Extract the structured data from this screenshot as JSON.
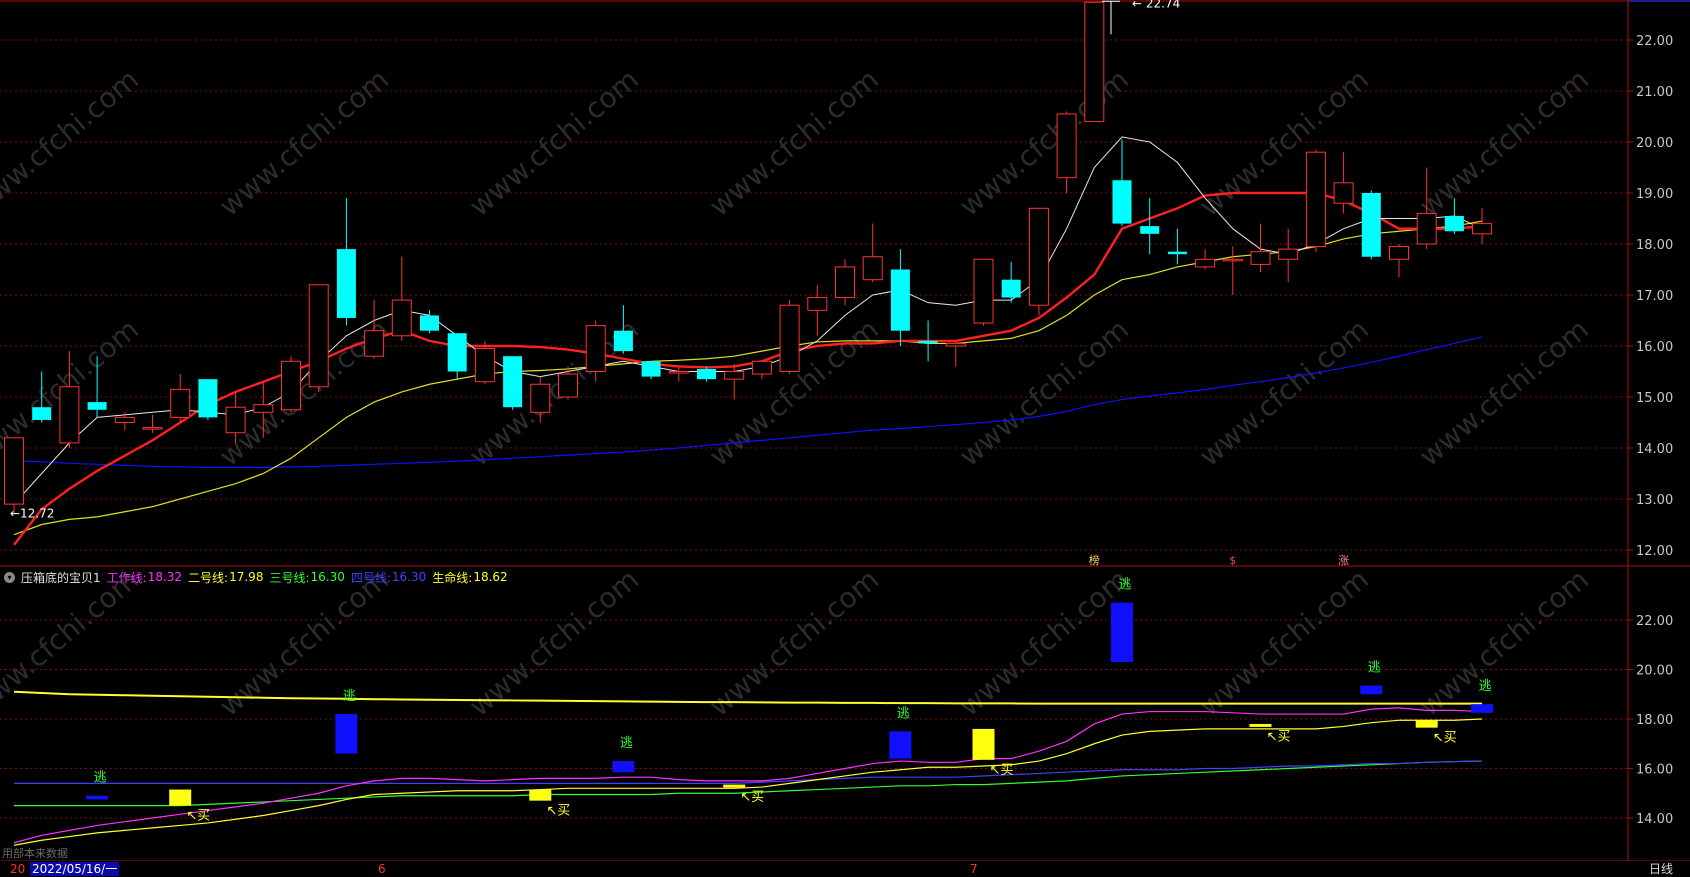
{
  "chart_data": [
    {
      "type": "candlestick",
      "ylim": [
        11.8,
        23.0
      ],
      "y_ticks": [
        "12.00",
        "13.00",
        "14.00",
        "15.00",
        "16.00",
        "17.00",
        "18.00",
        "19.00",
        "20.00",
        "21.00",
        "22.00"
      ],
      "top_tick_partial": "22.88",
      "grid": true,
      "annotations": [
        {
          "text": "22.74",
          "x": 40,
          "y": 22.74
        },
        {
          "text": "12.72",
          "x": 0,
          "y": 12.72
        }
      ],
      "event_marks": [
        {
          "text": "榜",
          "x": 39,
          "color": "#ffcc66"
        },
        {
          "text": "$",
          "x": 44,
          "color": "#ff4040"
        },
        {
          "text": "涨",
          "x": 48,
          "color": "#ff8080"
        }
      ],
      "candles": [
        {
          "o": 12.9,
          "h": 14.2,
          "l": 12.7,
          "c": 14.2
        },
        {
          "o": 14.8,
          "h": 15.5,
          "l": 14.5,
          "c": 14.55
        },
        {
          "o": 14.1,
          "h": 15.9,
          "l": 14.0,
          "c": 15.2
        },
        {
          "o": 14.9,
          "h": 15.8,
          "l": 14.6,
          "c": 14.75
        },
        {
          "o": 14.5,
          "h": 14.7,
          "l": 14.35,
          "c": 14.6
        },
        {
          "o": 14.4,
          "h": 14.65,
          "l": 14.3,
          "c": 14.4
        },
        {
          "o": 14.6,
          "h": 15.45,
          "l": 14.5,
          "c": 15.15
        },
        {
          "o": 15.35,
          "h": 15.35,
          "l": 14.55,
          "c": 14.6
        },
        {
          "o": 14.3,
          "h": 15.1,
          "l": 14.1,
          "c": 14.8
        },
        {
          "o": 14.7,
          "h": 15.3,
          "l": 14.2,
          "c": 14.85
        },
        {
          "o": 14.75,
          "h": 15.8,
          "l": 14.7,
          "c": 15.7
        },
        {
          "o": 15.2,
          "h": 17.2,
          "l": 15.1,
          "c": 17.2
        },
        {
          "o": 17.9,
          "h": 18.9,
          "l": 16.4,
          "c": 16.55
        },
        {
          "o": 15.8,
          "h": 16.9,
          "l": 15.75,
          "c": 16.3
        },
        {
          "o": 16.2,
          "h": 17.75,
          "l": 16.1,
          "c": 16.9
        },
        {
          "o": 16.6,
          "h": 16.7,
          "l": 16.25,
          "c": 16.3
        },
        {
          "o": 16.25,
          "h": 16.25,
          "l": 15.35,
          "c": 15.5
        },
        {
          "o": 15.3,
          "h": 16.1,
          "l": 15.25,
          "c": 15.95
        },
        {
          "o": 15.8,
          "h": 15.8,
          "l": 14.75,
          "c": 14.8
        },
        {
          "o": 14.7,
          "h": 15.4,
          "l": 14.5,
          "c": 15.25
        },
        {
          "o": 15.0,
          "h": 15.6,
          "l": 14.95,
          "c": 15.45
        },
        {
          "o": 15.5,
          "h": 16.5,
          "l": 15.3,
          "c": 16.4
        },
        {
          "o": 16.3,
          "h": 16.8,
          "l": 15.85,
          "c": 15.9
        },
        {
          "o": 15.7,
          "h": 15.7,
          "l": 15.35,
          "c": 15.4
        },
        {
          "o": 15.5,
          "h": 15.6,
          "l": 15.3,
          "c": 15.5
        },
        {
          "o": 15.55,
          "h": 15.6,
          "l": 15.3,
          "c": 15.35
        },
        {
          "o": 15.35,
          "h": 15.65,
          "l": 14.95,
          "c": 15.5
        },
        {
          "o": 15.45,
          "h": 15.65,
          "l": 15.35,
          "c": 15.7
        },
        {
          "o": 15.5,
          "h": 16.9,
          "l": 15.45,
          "c": 16.8
        },
        {
          "o": 16.7,
          "h": 17.2,
          "l": 16.2,
          "c": 16.95
        },
        {
          "o": 16.95,
          "h": 17.7,
          "l": 16.8,
          "c": 17.55
        },
        {
          "o": 17.3,
          "h": 18.4,
          "l": 17.25,
          "c": 17.75
        },
        {
          "o": 17.5,
          "h": 17.9,
          "l": 16.0,
          "c": 16.3
        },
        {
          "o": 16.1,
          "h": 16.5,
          "l": 15.7,
          "c": 16.05
        },
        {
          "o": 16.0,
          "h": 16.1,
          "l": 15.6,
          "c": 16.05
        },
        {
          "o": 16.45,
          "h": 17.7,
          "l": 16.4,
          "c": 17.7
        },
        {
          "o": 17.3,
          "h": 17.65,
          "l": 16.85,
          "c": 16.95
        },
        {
          "o": 16.8,
          "h": 18.7,
          "l": 16.6,
          "c": 18.7
        },
        {
          "o": 19.3,
          "h": 20.6,
          "l": 19.0,
          "c": 20.55
        },
        {
          "o": 20.4,
          "h": 22.74,
          "l": 20.4,
          "c": 22.74
        },
        {
          "o": 19.25,
          "h": 20.05,
          "l": 18.35,
          "c": 18.4
        },
        {
          "o": 18.35,
          "h": 18.9,
          "l": 17.8,
          "c": 18.2
        },
        {
          "o": 17.85,
          "h": 18.3,
          "l": 17.6,
          "c": 17.8
        },
        {
          "o": 17.55,
          "h": 17.9,
          "l": 17.5,
          "c": 17.7
        },
        {
          "o": 17.7,
          "h": 17.95,
          "l": 17.0,
          "c": 17.7
        },
        {
          "o": 17.6,
          "h": 18.4,
          "l": 17.45,
          "c": 17.85
        },
        {
          "o": 17.7,
          "h": 18.3,
          "l": 17.25,
          "c": 17.9
        },
        {
          "o": 17.95,
          "h": 19.85,
          "l": 17.85,
          "c": 19.8
        },
        {
          "o": 18.8,
          "h": 19.8,
          "l": 18.6,
          "c": 19.2
        },
        {
          "o": 19.0,
          "h": 19.05,
          "l": 17.7,
          "c": 17.75
        },
        {
          "o": 17.7,
          "h": 18.0,
          "l": 17.35,
          "c": 17.95
        },
        {
          "o": 18.0,
          "h": 19.5,
          "l": 17.9,
          "c": 18.6
        },
        {
          "o": 18.55,
          "h": 18.9,
          "l": 18.2,
          "c": 18.25
        },
        {
          "o": 18.2,
          "h": 18.7,
          "l": 18.0,
          "c": 18.4
        }
      ],
      "series": [
        {
          "color": "#e8e8e8",
          "values": [
            12.9,
            13.5,
            14.1,
            14.6,
            14.65,
            14.7,
            14.75,
            14.7,
            14.65,
            14.8,
            15.1,
            15.7,
            16.2,
            16.5,
            16.7,
            16.6,
            16.2,
            15.8,
            15.5,
            15.4,
            15.5,
            15.6,
            15.7,
            15.6,
            15.5,
            15.5,
            15.5,
            15.6,
            15.8,
            16.1,
            16.6,
            17.0,
            17.1,
            16.85,
            16.8,
            16.9,
            16.9,
            17.3,
            18.3,
            19.5,
            20.1,
            20.0,
            19.6,
            18.9,
            18.3,
            17.9,
            17.8,
            18.0,
            18.3,
            18.5,
            18.5,
            18.5,
            18.55,
            18.3
          ]
        },
        {
          "color": "#ff2020",
          "values": [
            12.1,
            12.8,
            13.2,
            13.55,
            13.85,
            14.15,
            14.5,
            14.85,
            15.1,
            15.3,
            15.5,
            15.7,
            15.95,
            16.15,
            16.3,
            16.1,
            16.0,
            16.0,
            16.0,
            15.98,
            15.93,
            15.85,
            15.75,
            15.65,
            15.6,
            15.58,
            15.6,
            15.7,
            15.9,
            16.0,
            16.05,
            16.05,
            16.1,
            16.1,
            16.1,
            16.2,
            16.3,
            16.55,
            16.95,
            17.4,
            18.3,
            18.5,
            18.7,
            18.95,
            19.0,
            19.0,
            19.0,
            19.0,
            18.85,
            18.6,
            18.3,
            18.3,
            18.3,
            18.35
          ]
        },
        {
          "color": "#e0e020",
          "values": [
            12.3,
            12.5,
            12.6,
            12.65,
            12.75,
            12.85,
            13.0,
            13.15,
            13.3,
            13.5,
            13.8,
            14.2,
            14.6,
            14.9,
            15.1,
            15.25,
            15.35,
            15.45,
            15.5,
            15.52,
            15.55,
            15.6,
            15.65,
            15.7,
            15.72,
            15.75,
            15.8,
            15.9,
            16.0,
            16.08,
            16.1,
            16.1,
            16.1,
            16.05,
            16.05,
            16.1,
            16.15,
            16.3,
            16.6,
            17.0,
            17.3,
            17.4,
            17.55,
            17.65,
            17.75,
            17.8,
            17.85,
            17.95,
            18.1,
            18.2,
            18.25,
            18.3,
            18.35,
            18.45
          ]
        },
        {
          "color": "#1010ff",
          "values": [
            13.75,
            13.73,
            13.7,
            13.68,
            13.66,
            13.64,
            13.63,
            13.62,
            13.62,
            13.62,
            13.63,
            13.64,
            13.66,
            13.68,
            13.7,
            13.72,
            13.74,
            13.77,
            13.8,
            13.83,
            13.86,
            13.89,
            13.92,
            13.96,
            14.0,
            14.05,
            14.1,
            14.15,
            14.2,
            14.25,
            14.3,
            14.35,
            14.38,
            14.42,
            14.46,
            14.5,
            14.55,
            14.62,
            14.72,
            14.85,
            14.95,
            15.02,
            15.08,
            15.15,
            15.23,
            15.3,
            15.38,
            15.47,
            15.57,
            15.68,
            15.8,
            15.93,
            16.05,
            16.18
          ]
        }
      ]
    },
    {
      "type": "indicator",
      "title": "压箱底的宝贝1",
      "ylim": [
        13.2,
        23.8
      ],
      "y_ticks": [
        "14.00",
        "16.00",
        "18.00",
        "20.00",
        "22.00"
      ],
      "legend": [
        {
          "label": "工作线:",
          "value": "18.32",
          "color": "#ff30ff"
        },
        {
          "label": "二号线:",
          "value": "17.98",
          "color": "#ffff30"
        },
        {
          "label": "三号线:",
          "value": "16.30",
          "color": "#30ff30"
        },
        {
          "label": "四号线:",
          "value": "16.30",
          "color": "#4040ff"
        },
        {
          "label": "生命线:",
          "value": "18.62",
          "color": "#ffff30"
        }
      ],
      "series": [
        {
          "color": "#ff30ff",
          "values": [
            13.0,
            13.3,
            13.5,
            13.7,
            13.85,
            14.0,
            14.15,
            14.3,
            14.45,
            14.6,
            14.8,
            15.0,
            15.3,
            15.5,
            15.6,
            15.6,
            15.55,
            15.5,
            15.55,
            15.6,
            15.6,
            15.6,
            15.65,
            15.65,
            15.55,
            15.5,
            15.5,
            15.5,
            15.6,
            15.8,
            16.0,
            16.2,
            16.3,
            16.25,
            16.25,
            16.4,
            16.4,
            16.7,
            17.1,
            17.8,
            18.2,
            18.3,
            18.3,
            18.3,
            18.25,
            18.2,
            18.2,
            18.2,
            18.2,
            18.4,
            18.45,
            18.35,
            18.35,
            18.3
          ]
        },
        {
          "color": "#ffff30",
          "values": [
            12.9,
            13.1,
            13.25,
            13.4,
            13.5,
            13.6,
            13.7,
            13.8,
            13.95,
            14.1,
            14.3,
            14.5,
            14.75,
            14.95,
            15.0,
            15.05,
            15.1,
            15.1,
            15.1,
            15.15,
            15.2,
            15.2,
            15.2,
            15.2,
            15.2,
            15.2,
            15.2,
            15.25,
            15.4,
            15.55,
            15.7,
            15.85,
            15.95,
            16.05,
            16.05,
            16.1,
            16.15,
            16.3,
            16.6,
            17.0,
            17.35,
            17.5,
            17.55,
            17.6,
            17.6,
            17.6,
            17.6,
            17.6,
            17.7,
            17.85,
            17.95,
            17.95,
            17.95,
            18.0
          ]
        },
        {
          "color": "#30ff30",
          "values": [
            14.5,
            14.5,
            14.5,
            14.5,
            14.5,
            14.5,
            14.5,
            14.55,
            14.6,
            14.65,
            14.7,
            14.75,
            14.8,
            14.85,
            14.9,
            14.9,
            14.9,
            14.9,
            14.9,
            14.95,
            14.95,
            14.95,
            14.95,
            14.95,
            15.0,
            15.0,
            15.0,
            15.05,
            15.1,
            15.15,
            15.2,
            15.25,
            15.3,
            15.3,
            15.35,
            15.35,
            15.4,
            15.45,
            15.5,
            15.6,
            15.7,
            15.75,
            15.8,
            15.85,
            15.9,
            15.95,
            16.0,
            16.05,
            16.1,
            16.15,
            16.2,
            16.25,
            16.28,
            16.3
          ]
        },
        {
          "color": "#4040ff",
          "values": [
            15.4,
            15.4,
            15.4,
            15.4,
            15.4,
            15.4,
            15.4,
            15.4,
            15.4,
            15.4,
            15.4,
            15.4,
            15.4,
            15.4,
            15.4,
            15.4,
            15.4,
            15.4,
            15.4,
            15.4,
            15.4,
            15.4,
            15.4,
            15.4,
            15.4,
            15.4,
            15.4,
            15.45,
            15.5,
            15.55,
            15.6,
            15.65,
            15.65,
            15.65,
            15.65,
            15.7,
            15.75,
            15.8,
            15.85,
            15.9,
            15.95,
            15.95,
            15.95,
            16.0,
            16.0,
            16.05,
            16.1,
            16.1,
            16.15,
            16.2,
            16.2,
            16.25,
            16.28,
            16.3
          ]
        },
        {
          "color": "#ffff30",
          "values": [
            19.1,
            19.05,
            19.0,
            18.98,
            18.96,
            18.94,
            18.92,
            18.9,
            18.88,
            18.86,
            18.84,
            18.83,
            18.82,
            18.8,
            18.79,
            18.78,
            18.77,
            18.76,
            18.75,
            18.74,
            18.73,
            18.72,
            18.71,
            18.7,
            18.69,
            18.68,
            18.68,
            18.67,
            18.66,
            18.66,
            18.65,
            18.65,
            18.64,
            18.64,
            18.63,
            18.63,
            18.63,
            18.62,
            18.62,
            18.62,
            18.62,
            18.62,
            18.62,
            18.62,
            18.62,
            18.62,
            18.62,
            18.62,
            18.62,
            18.62,
            18.62,
            18.62,
            18.62,
            18.62
          ]
        }
      ],
      "blue_bars": [
        {
          "x": 3,
          "top": 14.9,
          "bottom": 14.75,
          "label": "逃"
        },
        {
          "x": 12,
          "top": 18.2,
          "bottom": 16.6,
          "label": "逃"
        },
        {
          "x": 22,
          "top": 16.3,
          "bottom": 15.85,
          "label": "逃"
        },
        {
          "x": 32,
          "top": 17.5,
          "bottom": 16.4,
          "label": "逃"
        },
        {
          "x": 40,
          "top": 22.7,
          "bottom": 20.3,
          "label": "逃"
        },
        {
          "x": 49,
          "top": 19.35,
          "bottom": 19.0,
          "label": "逃"
        },
        {
          "x": 53,
          "top": 18.6,
          "bottom": 18.25,
          "label": "逃"
        }
      ],
      "yellow_bars": [
        {
          "x": 6,
          "top": 15.15,
          "bottom": 14.5,
          "label": "买"
        },
        {
          "x": 19,
          "top": 15.15,
          "bottom": 14.7,
          "label": "买"
        },
        {
          "x": 26,
          "top": 15.35,
          "bottom": 15.25,
          "label": "买"
        },
        {
          "x": 35,
          "top": 17.6,
          "bottom": 16.35,
          "label": "买"
        },
        {
          "x": 45,
          "top": 17.8,
          "bottom": 17.7,
          "label": "买"
        },
        {
          "x": 51,
          "top": 17.95,
          "bottom": 17.65,
          "label": "买"
        }
      ]
    }
  ],
  "ui": {
    "date_box": "2022/05/16/一",
    "ghost_text": "用部本来数据",
    "year_mark": "20",
    "month_6": "6",
    "month_7": "7",
    "period_label": "日线",
    "watermark": "www.cfchi.com"
  }
}
